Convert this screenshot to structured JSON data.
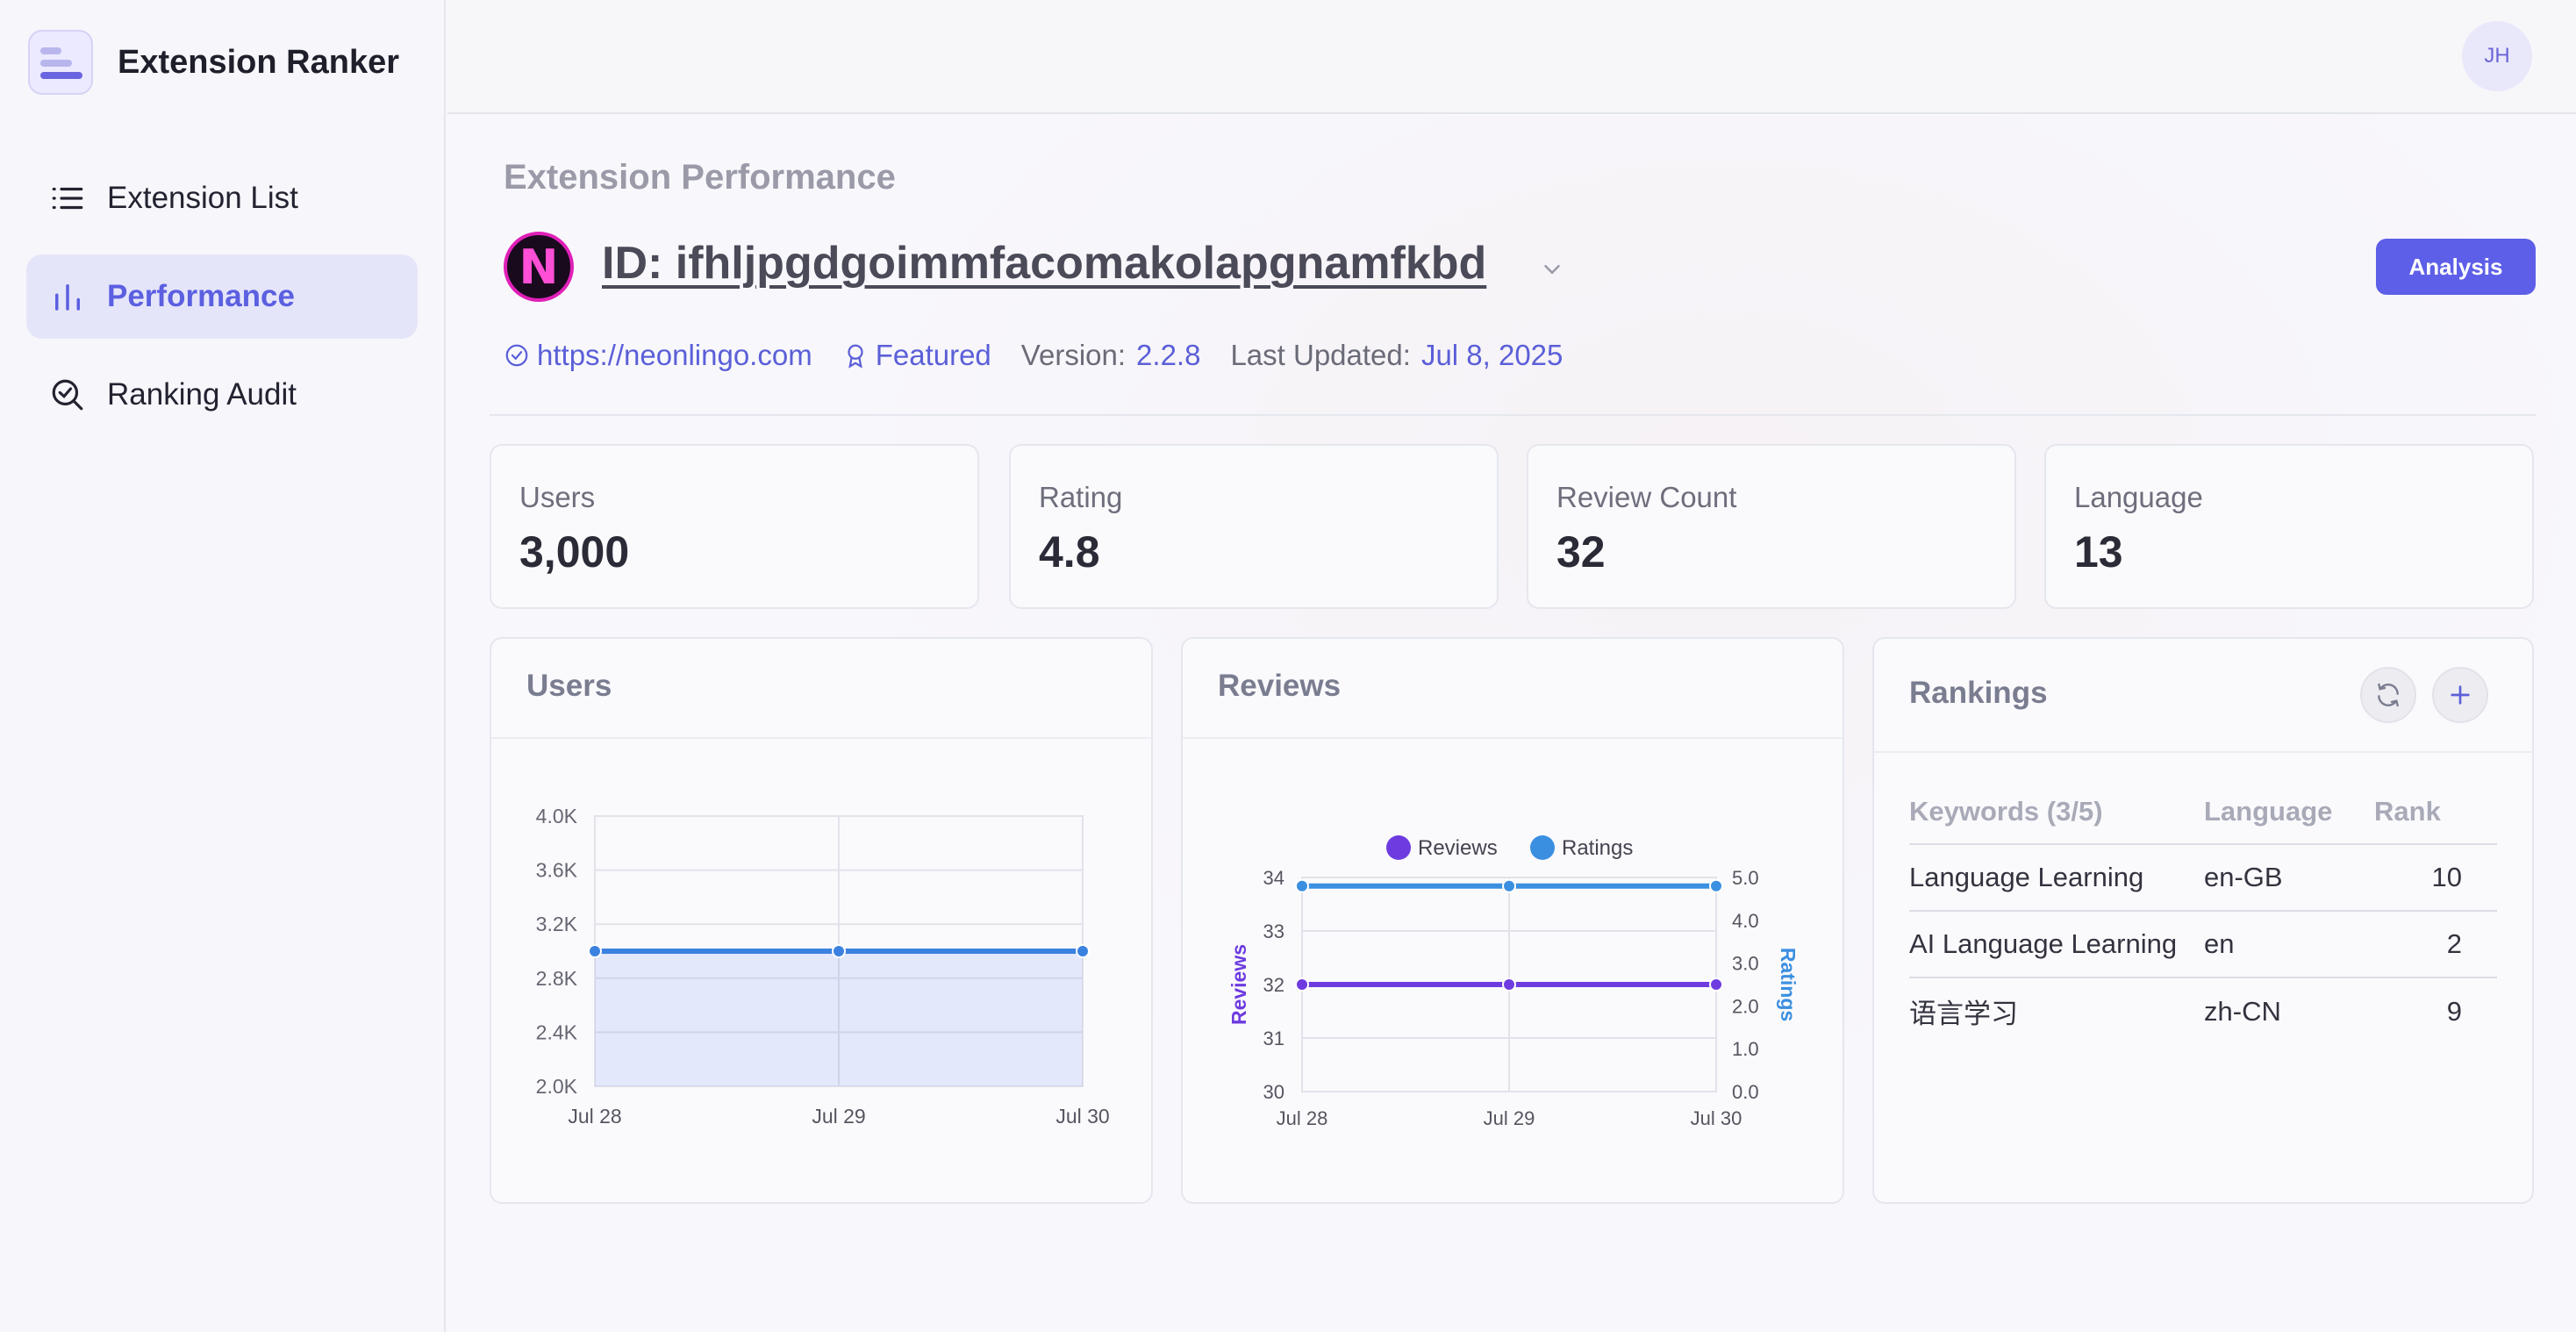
{
  "app": {
    "title": "Extension Ranker"
  },
  "sidebar": {
    "items": [
      {
        "label": "Extension List",
        "icon": "list-icon",
        "active": false
      },
      {
        "label": "Performance",
        "icon": "bar-chart-icon",
        "active": true
      },
      {
        "label": "Ranking Audit",
        "icon": "search-check-icon",
        "active": false
      }
    ]
  },
  "topbar": {
    "avatar_initials": "JH"
  },
  "page": {
    "title": "Extension Performance",
    "logo_letter": "N",
    "extension_id": "ID: ifhljpgdgoimmfacomakolapgnamfkbd",
    "analysis_label": "Analysis",
    "url": "https://neonlingo.com",
    "badge": "Featured",
    "version_label": "Version:",
    "version": "2.2.8",
    "updated_label": "Last Updated:",
    "updated": "Jul 8, 2025"
  },
  "stats": [
    {
      "label": "Users",
      "value": "3,000"
    },
    {
      "label": "Rating",
      "value": "4.8"
    },
    {
      "label": "Review Count",
      "value": "32"
    },
    {
      "label": "Language",
      "value": "13"
    }
  ],
  "cards": {
    "users_title": "Users",
    "reviews_title": "Reviews",
    "rankings_title": "Rankings"
  },
  "rankings": {
    "headers": [
      "Keywords (3/5)",
      "Language",
      "Rank"
    ],
    "rows": [
      {
        "keyword": "Language Learning",
        "language": "en-GB",
        "rank": "10"
      },
      {
        "keyword": "AI Language Learning",
        "language": "en",
        "rank": "2"
      },
      {
        "keyword": "语言学习",
        "language": "zh-CN",
        "rank": "9"
      }
    ]
  },
  "colors": {
    "accent": "#5d5fe8",
    "users_line": "#3b82e0",
    "reviews_line": "#6d3be0",
    "ratings_line": "#3b8fe0"
  },
  "chart_data": [
    {
      "type": "area",
      "categories": [
        "Jul 28",
        "Jul 29",
        "Jul 30"
      ],
      "series": [
        {
          "values": [
            3000,
            3000,
            3000
          ]
        }
      ],
      "ylim": [
        2000,
        4000
      ],
      "yticks": [
        "4.0K",
        "3.6K",
        "3.2K",
        "2.8K",
        "2.4K",
        "2.0K"
      ],
      "grid": true
    },
    {
      "type": "line",
      "categories": [
        "Jul 28",
        "Jul 29",
        "Jul 30"
      ],
      "series": [
        {
          "name": "Reviews",
          "values": [
            32,
            32,
            32
          ],
          "axis": "left"
        },
        {
          "name": "Ratings",
          "values": [
            4.8,
            4.8,
            4.8
          ],
          "axis": "right"
        }
      ],
      "ylabel": "Reviews",
      "y2label": "Ratings",
      "ylim": [
        30,
        34
      ],
      "y2lim": [
        0,
        5
      ],
      "yticks": [
        "34",
        "33",
        "32",
        "31",
        "30"
      ],
      "y2ticks": [
        "5.0",
        "4.0",
        "3.0",
        "2.0",
        "1.0",
        "0.0"
      ],
      "legend": "top",
      "grid": true
    }
  ]
}
